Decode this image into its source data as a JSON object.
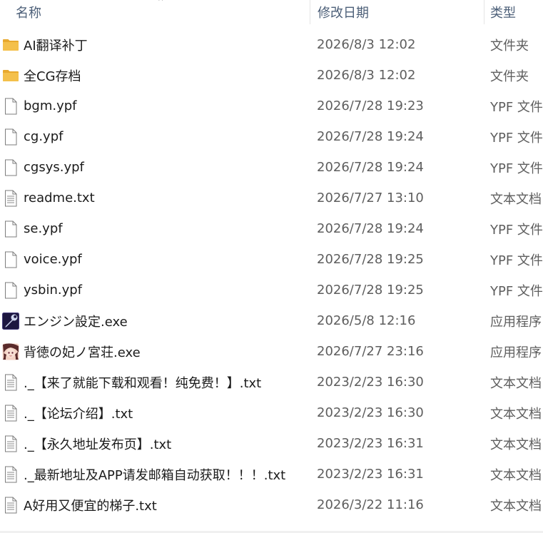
{
  "columns": {
    "name": "名称",
    "date": "修改日期",
    "type": "类型"
  },
  "files": [
    {
      "name": "AI翻译补丁",
      "date": "2026/8/3 12:02",
      "type": "文件夹",
      "icon": "folder-icon"
    },
    {
      "name": "全CG存档",
      "date": "2026/8/3 12:02",
      "type": "文件夹",
      "icon": "folder-icon"
    },
    {
      "name": "bgm.ypf",
      "date": "2026/7/28 19:23",
      "type": "YPF 文件",
      "icon": "file-icon"
    },
    {
      "name": "cg.ypf",
      "date": "2026/7/28 19:24",
      "type": "YPF 文件",
      "icon": "file-icon"
    },
    {
      "name": "cgsys.ypf",
      "date": "2026/7/28 19:24",
      "type": "YPF 文件",
      "icon": "file-icon"
    },
    {
      "name": "readme.txt",
      "date": "2026/7/27 13:10",
      "type": "文本文档",
      "icon": "text-file-icon"
    },
    {
      "name": "se.ypf",
      "date": "2026/7/28 19:24",
      "type": "YPF 文件",
      "icon": "file-icon"
    },
    {
      "name": "voice.ypf",
      "date": "2026/7/28 19:25",
      "type": "YPF 文件",
      "icon": "file-icon"
    },
    {
      "name": "ysbin.ypf",
      "date": "2026/7/28 19:25",
      "type": "YPF 文件",
      "icon": "file-icon"
    },
    {
      "name": "エンジン設定.exe",
      "date": "2026/5/8 12:16",
      "type": "应用程序",
      "icon": "engine-settings-app-icon"
    },
    {
      "name": "背徳の妃ノ宮荘.exe",
      "date": "2026/7/27 23:16",
      "type": "应用程序",
      "icon": "game-app-icon"
    },
    {
      "name": "._【来了就能下载和观看！纯免费！】.txt",
      "date": "2023/2/23 16:30",
      "type": "文本文档",
      "icon": "text-file-icon"
    },
    {
      "name": "._【论坛介绍】.txt",
      "date": "2023/2/23 16:30",
      "type": "文本文档",
      "icon": "text-file-icon"
    },
    {
      "name": "._【永久地址发布页】.txt",
      "date": "2023/2/23 16:31",
      "type": "文本文档",
      "icon": "text-file-icon"
    },
    {
      "name": "._最新地址及APP请发邮箱自动获取！！！.txt",
      "date": "2023/2/23 16:31",
      "type": "文本文档",
      "icon": "text-file-icon"
    },
    {
      "name": "A好用又便宜的梯子.txt",
      "date": "2026/3/22 11:16",
      "type": "文本文档",
      "icon": "text-file-icon"
    }
  ],
  "colors": {
    "folder": "#f4c04b",
    "header_text": "#4c5f78",
    "secondary_text": "#5e5e5e"
  }
}
